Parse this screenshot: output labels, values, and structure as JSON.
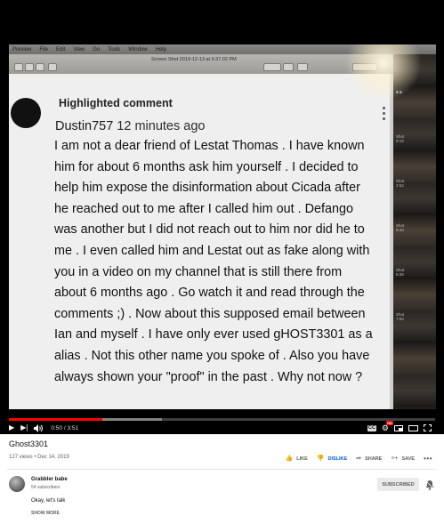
{
  "player": {
    "screen": {
      "menubar": [
        "Preview",
        "File",
        "Edit",
        "View",
        "Go",
        "Tools",
        "Window",
        "Help"
      ],
      "window_title": "Screen Shot 2019-12-13 at 9.37.02 PM"
    },
    "comment": {
      "heading": "Highlighted comment",
      "author": "Dustin757",
      "time": "12 minutes ago",
      "body": "I am not a dear friend of Lestat Thomas . I have known\nhim for about 6 months ask him yourself . I decided to\nhelp him expose the disinformation about Cicada after\nhe reached out to me after I called him out .  Defango\nwas another but I did not reach out to him nor did he to\nme  . I even called him and Lestat out as fake along with\nyou in a video on my channel that is still there from\nabout 6 months ago . Go watch it and read through the\ncomments ;) . Now about this supposed email between\nIan and myself . I have only ever used gHOST3301 as a\nalias . Not this other name you spoke of . Also you have\nalways shown your \"proof\" in the past . Why not now ?"
    },
    "controls": {
      "time": "0:50 / 3:51",
      "progress_played": 0.22,
      "progress_buffered": 0.36,
      "cc_label": "CC",
      "hd_badge": "HD"
    }
  },
  "video": {
    "title": "Ghost3301",
    "meta": "127 views • Dec 14, 2019",
    "actions": {
      "like": "LIKE",
      "dislike": "DISLIKE",
      "share": "SHARE",
      "save": "SAVE",
      "more": "•••"
    }
  },
  "channel": {
    "name": "Grabbler babe",
    "subscribers": "54 subscribers",
    "subscribe_label": "SUBSCRIBED",
    "description": "Okay, let's talk",
    "show_more": "SHOW MORE"
  },
  "colors": {
    "progress_red": "#ff0000",
    "dislike_active": "#065fd4",
    "player_bg": "#000000"
  }
}
